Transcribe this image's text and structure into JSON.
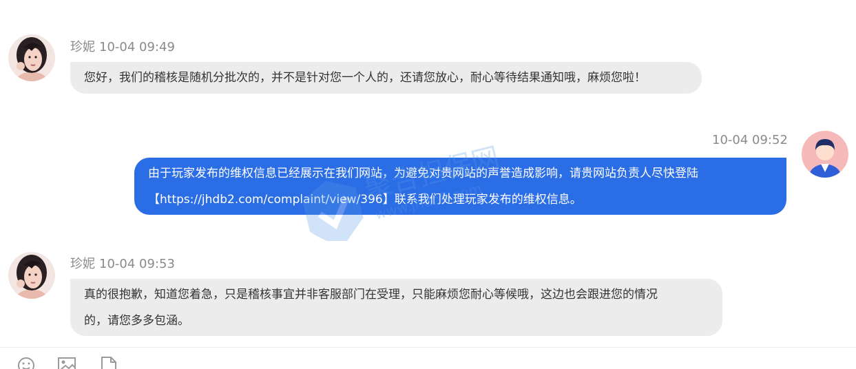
{
  "messages": [
    {
      "side": "left",
      "sender": "珍妮",
      "time": "10-04 09:49",
      "text": "您好，我们的稽核是随机分批次的，并不是针对您一个人的，还请您放心，耐心等待结果通知哦，麻烦您啦！"
    },
    {
      "side": "right",
      "time": "10-04 09:52",
      "line1": "由于玩家发布的维权信息已经展示在我们网站，为避免对贵网站的声誉造成影响，请贵网站负责人尽快登陆",
      "line2": "【https://jhdb2.com/complaint/view/396】联系我们处理玩家发布的维权信息。"
    },
    {
      "side": "left",
      "sender": "珍妮",
      "time": "10-04 09:53",
      "line1": "真的很抱歉，知道您着急，只是稽核事宜并非客服部门在受理，只能麻烦您耐心等候哦，这边也会跟进您的情况",
      "line2": "的，请您多多包涵。"
    }
  ],
  "watermark": {
    "text_main": "聚合担保网",
    "text_url": "www.jhdb8.com"
  },
  "toolbar": {
    "icons": [
      "emoji-icon",
      "image-icon",
      "file-icon"
    ]
  },
  "colors": {
    "user_bubble": "#2b6de5",
    "agent_bubble": "#ececec",
    "meta_text": "#8a8a8a"
  }
}
